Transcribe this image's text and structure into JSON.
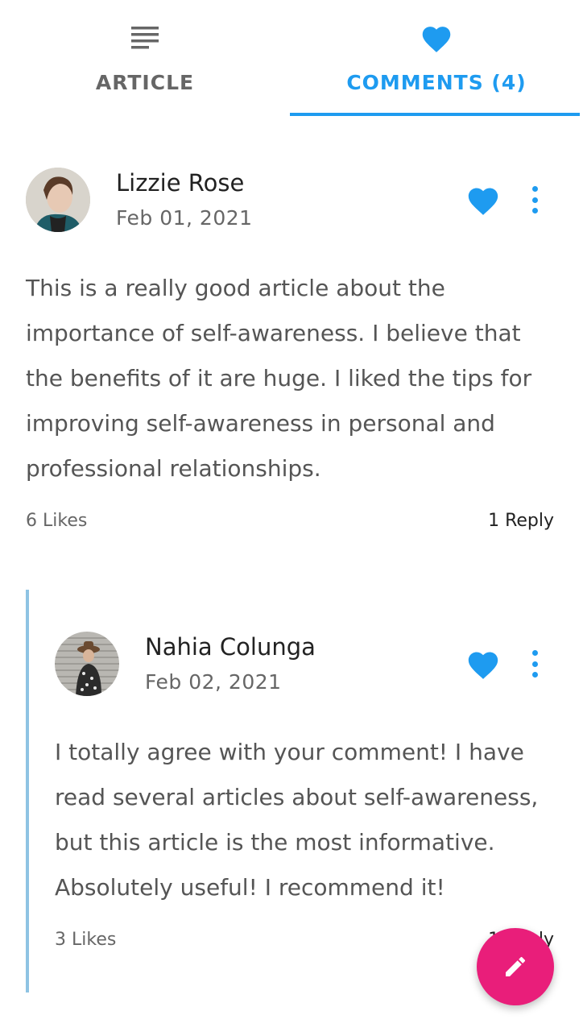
{
  "tabs": {
    "article": {
      "label": "ARTICLE",
      "icon": "article-lines-icon"
    },
    "comments": {
      "label": "COMMENTS (4)",
      "icon": "heart-icon"
    }
  },
  "colors": {
    "accent": "#1e9bf0",
    "fab": "#e91e7a",
    "thread_line": "#8ec3e3"
  },
  "comments": [
    {
      "author": "Lizzie Rose",
      "date": "Feb 01, 2021",
      "text": "This is a really good article about the importance of self-awareness. I believe that the benefits of it are huge. I liked the tips for improving self-awareness in personal and professional relationships.",
      "likes": "6 Likes",
      "replies": "1 Reply"
    },
    {
      "author": "Nahia Colunga",
      "date": "Feb 02, 2021",
      "text": "I totally agree with your comment! I have read several articles about self-awareness, but this article is the most informative. Absolutely useful! I recommend it!",
      "likes": "3 Likes",
      "replies": "1 Reply"
    }
  ],
  "fab": {
    "icon": "pencil-edit-icon"
  }
}
